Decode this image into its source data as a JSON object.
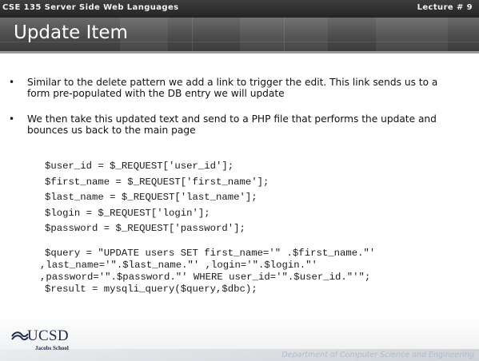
{
  "header": {
    "course": "CSE 135   Server Side Web Languages",
    "lecture": "Lecture # 9"
  },
  "slide": {
    "title": "Update Item"
  },
  "bullets": [
    {
      "text": "Similar to the delete pattern we add a link to trigger the edit.  This link sends us to a form pre-populated with the DB entry we will update"
    },
    {
      "text": "We then take this updated text and send to a PHP file that performs the update and bounces us back to the main page"
    }
  ],
  "code": {
    "line1": "$user_id = $_REQUEST['user_id'];",
    "line2": "$first_name = $_REQUEST['first_name'];",
    "line3": "$last_name = $_REQUEST['last_name'];",
    "line4": "$login = $_REQUEST['login'];",
    "line5": "$password = $_REQUEST['password'];",
    "query1": "$query = \"UPDATE users SET first_name='\" .$first_name.\"'",
    "query2": ",last_name='\".$last_name.\"' ,login='\".$login.\"'",
    "query3": ",password='\".$password.\"' WHERE user_id='\".$user_id.\"'\";",
    "query4": "$result = mysqli_query($query,$dbc);"
  },
  "footer": {
    "logo_text": "UCSD",
    "logo_subtext": "Jacobs School",
    "department": "Department of Computer Science and Engineering"
  },
  "colors": {
    "header_background": "#2e2e2e",
    "title_background": "#555555",
    "logo_blue": "#1d2a52",
    "footer_text": "#b5bdc6"
  }
}
